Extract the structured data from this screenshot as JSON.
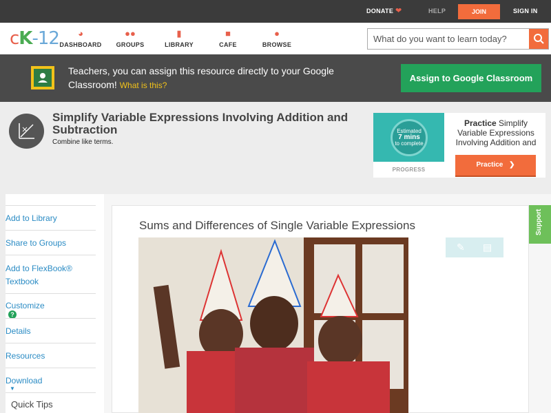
{
  "topbar": {
    "donate": "DONATE",
    "help": "HELP",
    "join": "JOIN",
    "signin": "SIGN IN"
  },
  "logo": {
    "c": "c",
    "k": "K",
    "n": "-12"
  },
  "nav": [
    {
      "label": "DASHBOARD",
      "icon": "dashboard-icon"
    },
    {
      "label": "GROUPS",
      "icon": "groups-icon"
    },
    {
      "label": "LIBRARY",
      "icon": "library-icon"
    },
    {
      "label": "CAFE",
      "icon": "cafe-icon"
    },
    {
      "label": "BROWSE",
      "icon": "browse-icon"
    }
  ],
  "search": {
    "placeholder": "What do you want to learn today?"
  },
  "banner": {
    "message": "Teachers, you can assign this resource directly to your Google Classroom!",
    "what": "What is this?",
    "assign": "Assign to Google Classroom"
  },
  "header": {
    "title": "Simplify Variable Expressions Involving Addition and Subtraction",
    "subtitle": "Combine like terms."
  },
  "practice": {
    "estimated": "Estimated",
    "mins": "7 mins",
    "to_complete": "to complete",
    "progress": "PROGRESS",
    "practice_word": "Practice",
    "practice_text": "Simplify Variable Expressions Involving Addition and",
    "button": "Practice"
  },
  "sidebar": {
    "items": [
      {
        "label": "Add to Library"
      },
      {
        "label": "Share to Groups"
      },
      {
        "label": "Add to FlexBook® Textbook"
      },
      {
        "label": "Customize"
      },
      {
        "label": "Details"
      },
      {
        "label": "Resources"
      },
      {
        "label": "Download"
      }
    ],
    "customize_badge": "?",
    "quick_tips": "Quick Tips"
  },
  "lesson": {
    "title": "Sums and Differences of Single Variable Expressions"
  },
  "support": "Support",
  "colors": {
    "accent": "#f26c3c",
    "green": "#23a25a",
    "link": "#2a8bc4",
    "dark": "#3b3b3b"
  }
}
